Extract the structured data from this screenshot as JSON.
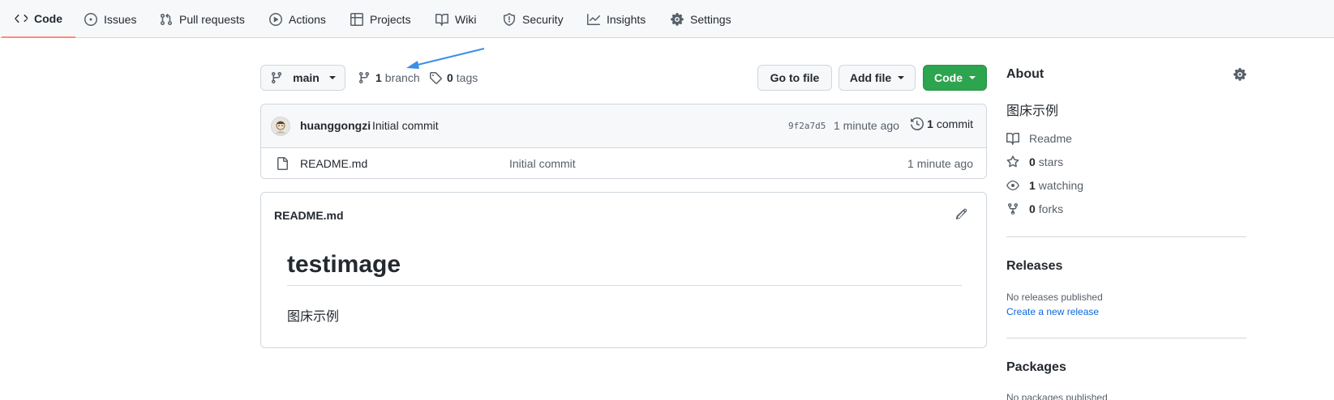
{
  "nav": {
    "tabs": [
      {
        "label": "Code"
      },
      {
        "label": "Issues"
      },
      {
        "label": "Pull requests"
      },
      {
        "label": "Actions"
      },
      {
        "label": "Projects"
      },
      {
        "label": "Wiki"
      },
      {
        "label": "Security"
      },
      {
        "label": "Insights"
      },
      {
        "label": "Settings"
      }
    ]
  },
  "toolbar": {
    "branch_name": "main",
    "branch_count": "1",
    "branch_label": "branch",
    "tag_count": "0",
    "tag_label": "tags",
    "go_to_file": "Go to file",
    "add_file": "Add file",
    "code": "Code"
  },
  "commit": {
    "author": "huanggongzi",
    "message": "Initial commit",
    "sha": "9f2a7d5",
    "age": "1 minute ago",
    "count": "1",
    "count_label": "commit"
  },
  "files": [
    {
      "name": "README.md",
      "message": "Initial commit",
      "age": "1 minute ago"
    }
  ],
  "readme": {
    "filename": "README.md",
    "heading": "testimage",
    "body": "图床示例"
  },
  "sidebar": {
    "about_title": "About",
    "description": "图床示例",
    "readme_label": "Readme",
    "stars_count": "0",
    "stars_label": "stars",
    "watching_count": "1",
    "watching_label": "watching",
    "forks_count": "0",
    "forks_label": "forks",
    "releases_title": "Releases",
    "releases_empty": "No releases published",
    "create_release": "Create a new release",
    "packages_title": "Packages",
    "packages_empty": "No packages published"
  },
  "colors": {
    "primary_button": "#2da44e",
    "selected_tab_underline": "#fd8c73",
    "link": "#0969da",
    "annotation_arrow": "#3b8ee8"
  }
}
